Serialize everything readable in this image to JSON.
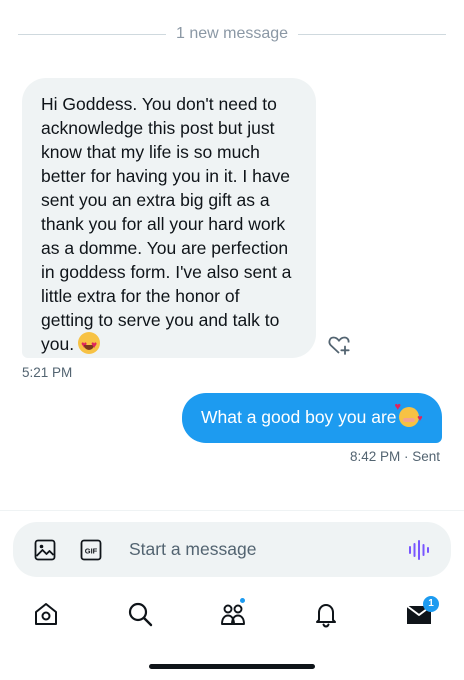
{
  "divider": {
    "text": "1 new message"
  },
  "messages": {
    "incoming": {
      "text": "Hi Goddess. You don't need to\nacknowledge this post but just\nknow that my life is so much\nbetter for having you in it. I have\nsent you an extra big gift as a\nthank you for all your hard work\nas a domme. You are perfection\nin goddess form. I've also sent a\nlittle extra for the honor of\ngetting to serve you and talk to\nyou.",
      "emoji": "smiling-face-with-heart-eyes",
      "time": "5:21 PM"
    },
    "outgoing": {
      "text": "What a good boy you are",
      "emoji": "smiling-face-with-hearts",
      "meta": "8:42 PM · Sent"
    }
  },
  "composer": {
    "placeholder": "Start a message",
    "gif_label": "GIF"
  },
  "nav": {
    "items": [
      "home-icon",
      "search-icon",
      "communities-icon",
      "notifications-icon",
      "messages-icon"
    ],
    "messages_badge": "1"
  },
  "colors": {
    "accent": "#1d9bf0",
    "bubble_incoming": "#eff3f4",
    "text_secondary": "#536471",
    "voice_icon": "#7856ff"
  }
}
